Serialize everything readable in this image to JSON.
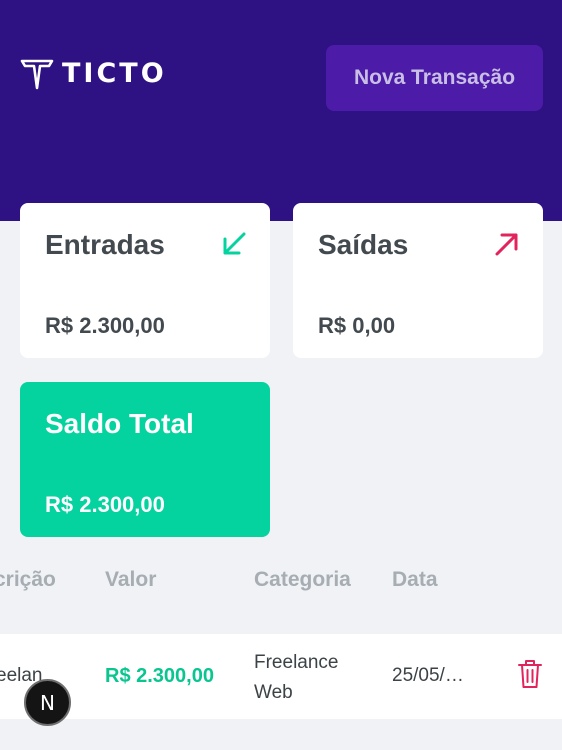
{
  "header": {
    "logo_text": "TICTO",
    "new_transaction_label": "Nova Transação",
    "background_color": "#2e1182",
    "button_color": "#4c1ba8"
  },
  "summary": {
    "income": {
      "title": "Entradas",
      "value": "R$ 2.300,00",
      "icon": "arrow-down-left-icon",
      "icon_color": "#04d39f"
    },
    "expense": {
      "title": "Saídas",
      "value": "R$ 0,00",
      "icon": "arrow-up-right-icon",
      "icon_color": "#e1245c"
    },
    "total": {
      "title": "Saldo Total",
      "value": "R$ 2.300,00",
      "background_color": "#04d39f"
    }
  },
  "table": {
    "headers": [
      "crição",
      "Valor",
      "Categoria",
      "Data"
    ],
    "rows": [
      {
        "description": "eelan",
        "value": "R$ 2.300,00",
        "category": "Freelance Web",
        "date": "25/05/…",
        "action_icon": "trash-icon"
      }
    ]
  },
  "dev_badge": {
    "label": "N",
    "icon": "nextjs-icon"
  }
}
